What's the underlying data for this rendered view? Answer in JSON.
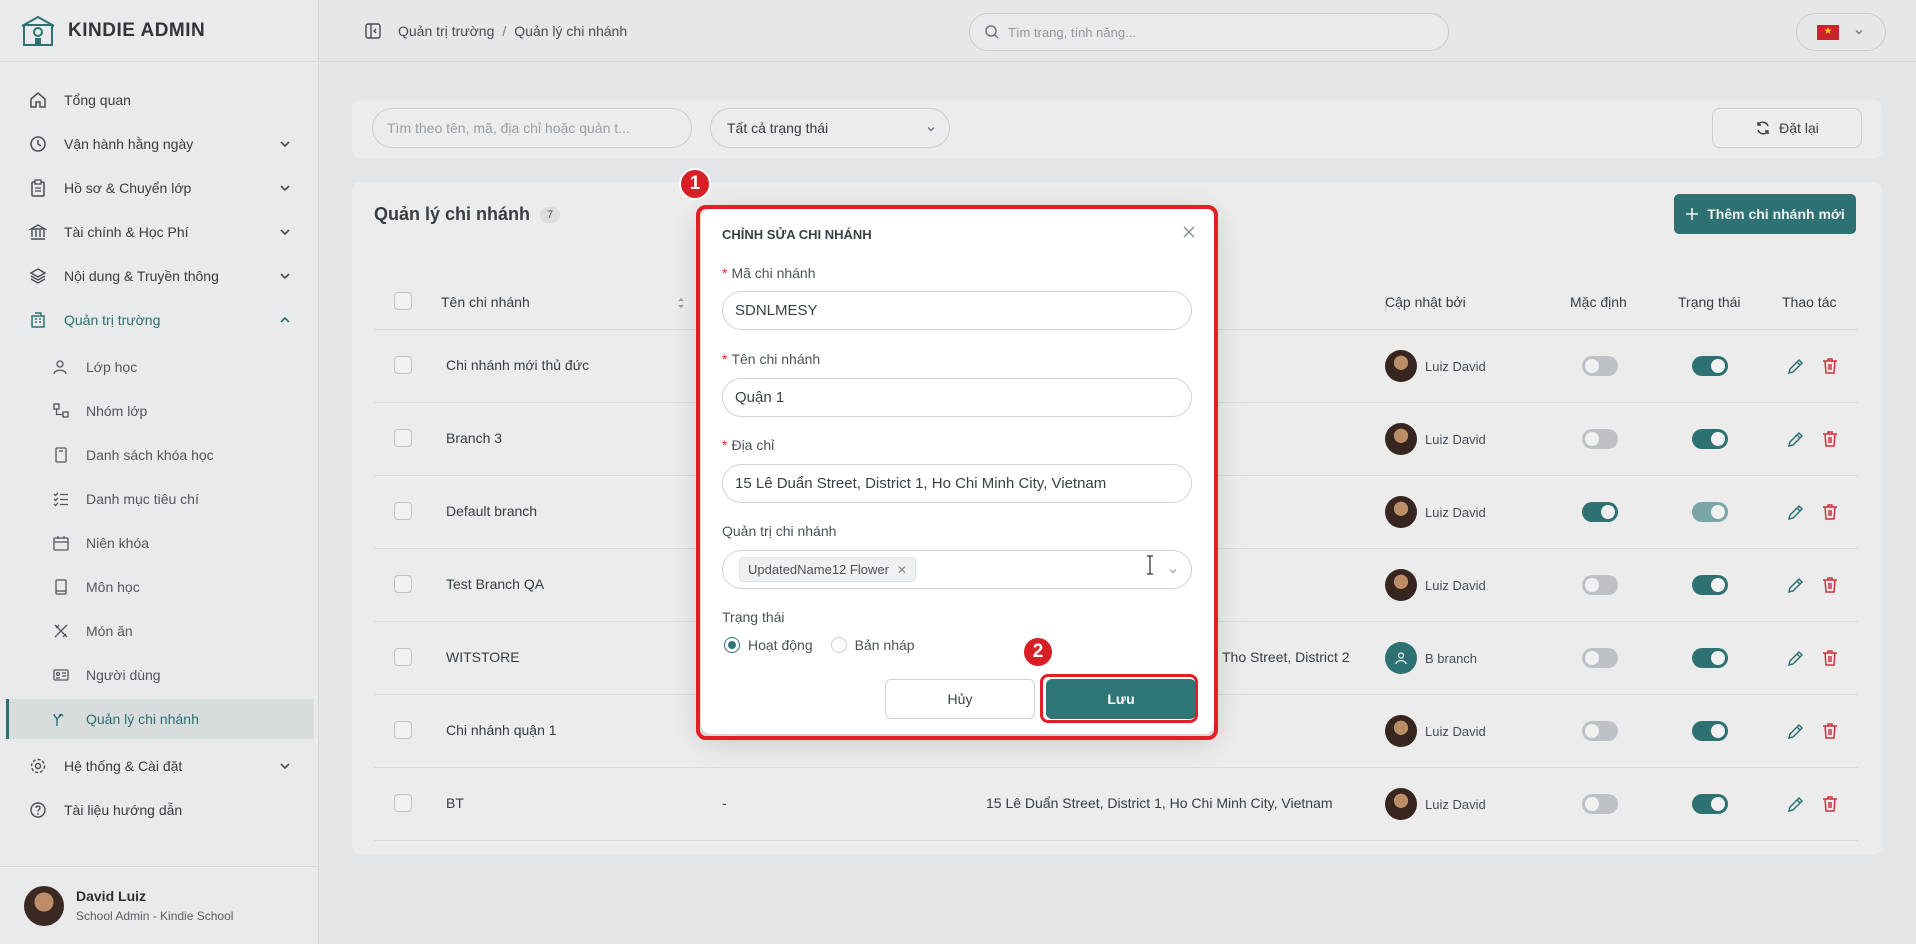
{
  "brand": {
    "name": "KINDIE ADMIN"
  },
  "sidebar": {
    "items": [
      {
        "label": "Tổng quan",
        "icon": "home-icon"
      },
      {
        "label": "Vận hành hằng ngày",
        "icon": "clock-icon"
      },
      {
        "label": "Hồ sơ & Chuyển lớp",
        "icon": "clipboard-icon"
      },
      {
        "label": "Tài chính & Học Phí",
        "icon": "bank-icon"
      },
      {
        "label": "Nội dung & Truyền thông",
        "icon": "layers-icon"
      },
      {
        "label": "Quản trị trường",
        "icon": "building-icon"
      },
      {
        "label": "Hệ thống & Cài đặt",
        "icon": "gear-icon"
      },
      {
        "label": "Tài liệu hướng dẫn",
        "icon": "help-icon"
      }
    ],
    "subitems": [
      {
        "label": "Lớp học"
      },
      {
        "label": "Nhóm lớp"
      },
      {
        "label": "Danh sách khóa học"
      },
      {
        "label": "Danh mục tiêu chí"
      },
      {
        "label": "Niên khóa"
      },
      {
        "label": "Môn học"
      },
      {
        "label": "Món ăn"
      },
      {
        "label": "Người dùng"
      },
      {
        "label": "Quản lý chi nhánh"
      }
    ]
  },
  "profile": {
    "name": "David Luiz",
    "role": "School Admin - Kindie School"
  },
  "breadcrumb": {
    "parent": "Quản trị trường",
    "separator": "/",
    "current": "Quản lý chi nhánh"
  },
  "search": {
    "placeholder": "Tìm trang, tính năng..."
  },
  "filters": {
    "search_placeholder": "Tìm theo tên, mã, địa chỉ hoặc quản t...",
    "status_value": "Tất cả trạng thái",
    "reset_label": "Đặt lại"
  },
  "page": {
    "title": "Quản lý chi nhánh",
    "count": "7",
    "add_label": "Thêm chi nhánh mới"
  },
  "table": {
    "columns": {
      "name": "Tên chi nhánh",
      "updated_by": "Cập nhật bởi",
      "default": "Mặc định",
      "status": "Trạng thái",
      "actions": "Thao tác"
    },
    "rows": [
      {
        "name": "Chi nhánh mới thủ đức",
        "code": "",
        "address": "",
        "updated_by": "Luiz David",
        "is_default": false,
        "active": true
      },
      {
        "name": "Branch 3",
        "code": "",
        "address": "",
        "updated_by": "Luiz David",
        "is_default": false,
        "active": true
      },
      {
        "name": "Default branch",
        "code": "",
        "address": "",
        "updated_by": "Luiz David",
        "is_default": true,
        "active": true
      },
      {
        "name": "Test Branch QA",
        "code": "",
        "address": "",
        "updated_by": "Luiz David",
        "is_default": false,
        "active": true
      },
      {
        "name": "WITSTORE",
        "code": "",
        "address": "Tho Street, District 2",
        "updated_by": "B branch",
        "is_default": false,
        "active": true
      },
      {
        "name": "Chi nhánh quận 1",
        "code": "",
        "address": "",
        "updated_by": "Luiz David",
        "is_default": false,
        "active": true
      },
      {
        "name": "BT",
        "code": "-",
        "address": "15 Lê Duẩn Street, District 1, Ho Chi Minh City, Vietnam",
        "updated_by": "Luiz David",
        "is_default": false,
        "active": true
      }
    ]
  },
  "modal": {
    "title": "CHỈNH SỬA CHI NHÁNH",
    "fields": {
      "code_label": "Mã chi nhánh",
      "code_value": "SDNLMESY",
      "name_label": "Tên chi nhánh",
      "name_value": "Quận 1",
      "address_label": "Địa chỉ",
      "address_value": "15 Lê Duẩn Street, District 1, Ho Chi Minh City, Vietnam",
      "admin_label": "Quản trị chi nhánh",
      "admin_tag": "UpdatedName12 Flower",
      "status_label": "Trạng thái",
      "status_active": "Hoạt động",
      "status_draft": "Bản nháp",
      "required_mark": "*"
    },
    "cancel_label": "Hủy",
    "save_label": "Lưu"
  },
  "markers": {
    "first": "1",
    "second": "2"
  },
  "colors": {
    "accent": "#2f7777",
    "highlight": "#e21f26"
  }
}
